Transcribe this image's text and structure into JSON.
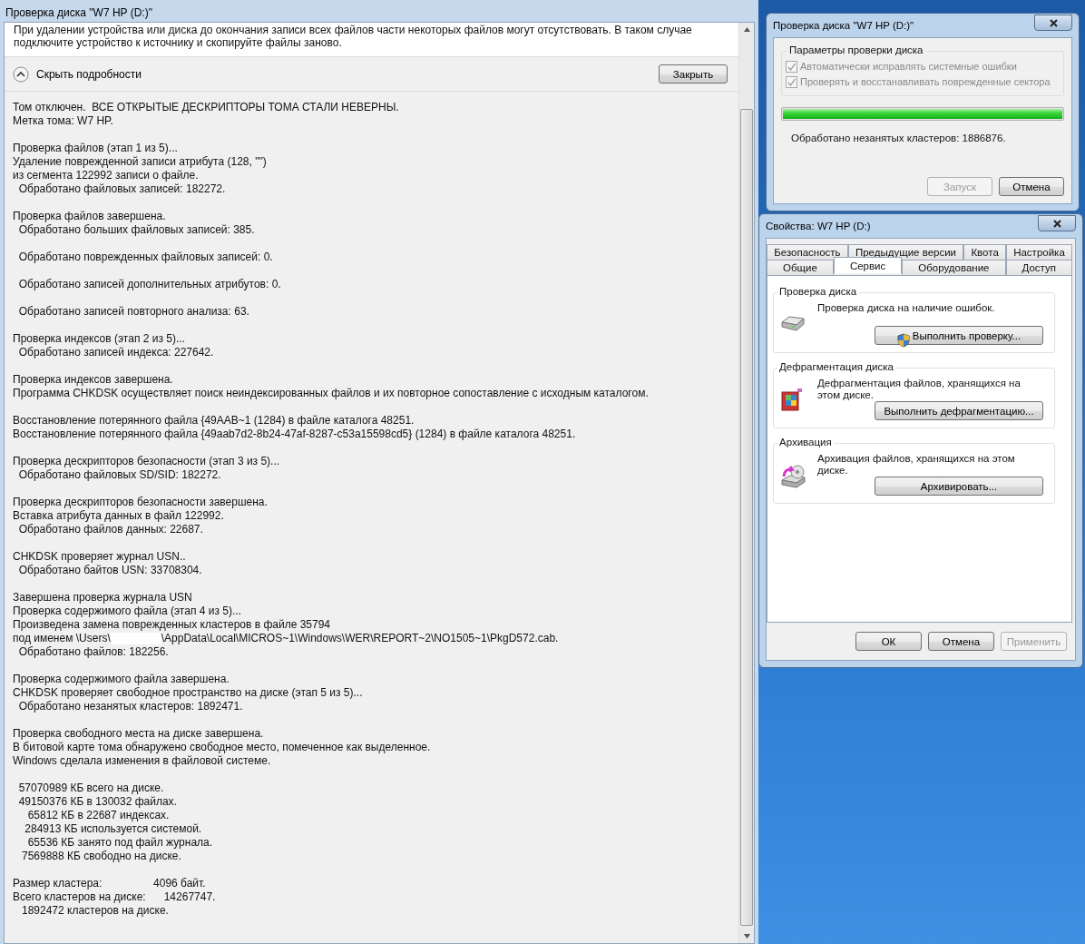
{
  "chkdsk_window": {
    "title": "Проверка диска \"W7 HP (D:)\"",
    "message": [
      "При удалении устройства или диска до окончания записи всех файлов части некоторых файлов могут отсутствовать. В таком случае",
      "подключите устройство к источнику и скопируйте файлы заново."
    ],
    "details_toggle": {
      "label": "Скрыть подробности",
      "expanded": true
    },
    "close_button": "Закрыть",
    "log": [
      [
        "Том отключен.  ВСЕ ОТКРЫТЫЕ ДЕСКРИПТОРЫ ТОМА СТАЛИ НЕВЕРНЫ.",
        "Метка тома: W7 HP."
      ],
      [
        "Проверка файлов (этап 1 из 5)...",
        "Удаление поврежденной записи атрибута (128, \"\")",
        "из сегмента 122992 записи о файле.",
        "  Обработано файловых записей: 182272."
      ],
      [
        "Проверка файлов завершена.",
        "  Обработано больших файловых записей: 385."
      ],
      [
        "  Обработано поврежденных файловых записей: 0."
      ],
      [
        "  Обработано записей дополнительных атрибутов: 0."
      ],
      [
        "  Обработано записей повторного анализа: 63."
      ],
      [
        "Проверка индексов (этап 2 из 5)...",
        "  Обработано записей индекса: 227642."
      ],
      [
        "Проверка индексов завершена.",
        "Программа CHKDSK осуществляет поиск неиндексированных файлов и их повторное сопоставление с исходным каталогом."
      ],
      [
        "Восстановление потерянного файла {49AAB~1 (1284) в файле каталога 48251.",
        "Восстановление потерянного файла {49aab7d2-8b24-47af-8287-c53a15598cd5} (1284) в файле каталога 48251."
      ],
      [
        "Проверка дескрипторов безопасности (этап 3 из 5)...",
        "  Обработано файловых SD/SID: 182272."
      ],
      [
        "Проверка дескрипторов безопасности завершена.",
        "Вставка атрибута данных в файл 122992.",
        "  Обработано файлов данных: 22687."
      ],
      [
        "CHKDSK проверяет журнал USN..",
        "  Обработано байтов USN: 33708304."
      ],
      [
        "Завершена проверка журнала USN",
        "Проверка содержимого файла (этап 4 из 5)...",
        "Произведена замена поврежденных кластеров в файле 35794",
        {
          "kind": "redacted",
          "before": "под именем \\Users\\",
          "after": "\\AppData\\Local\\MICROS~1\\Windows\\WER\\REPORT~2\\NO1505~1\\PkgD572.cab."
        },
        "  Обработано файлов: 182256."
      ],
      [
        "Проверка содержимого файла завершена.",
        "CHKDSK проверяет свободное пространство на диске (этап 5 из 5)...",
        "  Обработано незанятых кластеров: 1892471."
      ],
      [
        "Проверка свободного места на диске завершена.",
        "В битовой карте тома обнаружено свободное место, помеченное как выделенное.",
        "Windows сделала изменения в файловой системе."
      ],
      [
        "  57070989 КБ всего на диске.",
        "  49150376 КБ в 130032 файлах.",
        "     65812 КБ в 22687 индексах.",
        "    284913 КБ используется системой.",
        "     65536 КБ занято под файл журнала.",
        "   7569888 КБ свободно на диске."
      ],
      [
        "Размер кластера:                 4096 байт.",
        "Всего кластеров на диске:      14267747.",
        "   1892472 кластеров на диске."
      ]
    ]
  },
  "check_dialog": {
    "title": "Проверка диска \"W7 HP (D:)\"",
    "group_title": "Параметры проверки диска",
    "options": [
      {
        "label": "Автоматически исправлять системные ошибки",
        "checked": true,
        "disabled": true
      },
      {
        "label": "Проверять и восстанавливать поврежденные сектора",
        "checked": true,
        "disabled": true
      }
    ],
    "progress": {
      "level": 1
    },
    "status": "Обработано незанятых кластеров: 1886876.",
    "buttons": [
      {
        "label": "Запуск",
        "disabled": true
      },
      {
        "label": "Отмена",
        "disabled": false
      }
    ]
  },
  "properties_dialog": {
    "title": "Свойства: W7 HP (D:)",
    "tab_rows": [
      [
        {
          "label": "Безопасность",
          "selected": false
        },
        {
          "label": "Предыдущие версии",
          "selected": false
        },
        {
          "label": "Квота",
          "selected": false
        },
        {
          "label": "Настройка",
          "selected": false
        }
      ],
      [
        {
          "label": "Общие",
          "selected": false
        },
        {
          "label": "Сервис",
          "selected": true
        },
        {
          "label": "Оборудование",
          "selected": false
        },
        {
          "label": "Доступ",
          "selected": false
        }
      ]
    ],
    "sections": [
      {
        "kind": "check",
        "title": "Проверка диска",
        "description": "Проверка диска на наличие ошибок.",
        "button": {
          "label": "Выполнить проверку...",
          "shield": true
        }
      },
      {
        "kind": "defrag",
        "title": "Дефрагментация диска",
        "description": "Дефрагментация файлов, хранящихся на этом диске.",
        "button": {
          "label": "Выполнить дефрагментацию...",
          "shield": false
        }
      },
      {
        "kind": "backup",
        "title": "Архивация",
        "description": "Архивация файлов, хранящихся на этом диске.",
        "button": {
          "label": "Архивировать...",
          "shield": false
        }
      }
    ],
    "buttons": [
      {
        "label": "ОК",
        "disabled": false
      },
      {
        "label": "Отмена",
        "disabled": false
      },
      {
        "label": "Применить",
        "disabled": true
      }
    ]
  }
}
